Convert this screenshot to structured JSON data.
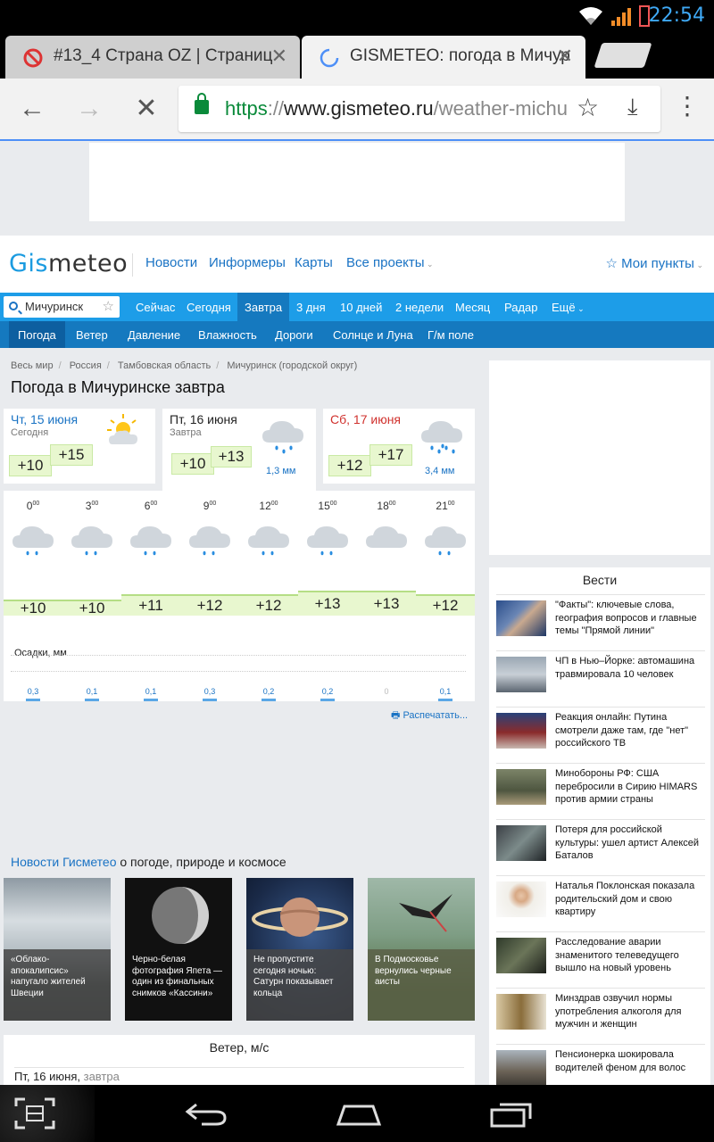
{
  "status_bar": {
    "time": "22:54"
  },
  "tabs": [
    {
      "title": "#13_4 Страна OZ | Страниц",
      "active": false
    },
    {
      "title": "GISMETEO: погода в Мичур",
      "active": true
    }
  ],
  "omnibox": {
    "scheme": "https",
    "sep": "://",
    "host": "www.gismeteo.ru",
    "path": "/weather-michu"
  },
  "site": {
    "logo_a": "Gis",
    "logo_b": "meteo",
    "nav": [
      "Новости",
      "Информеры",
      "Карты",
      "Все проекты"
    ],
    "my_points": "Мои пункты"
  },
  "city_search": {
    "value": "Мичуринск"
  },
  "period_nav": [
    "Сейчас",
    "Сегодня",
    "Завтра",
    "3 дня",
    "10 дней",
    "2 недели",
    "Месяц",
    "Радар",
    "Ещё"
  ],
  "sub_nav": [
    "Погода",
    "Ветер",
    "Давление",
    "Влажность",
    "Дороги",
    "Солнце и Луна",
    "Г/м поле"
  ],
  "breadcrumbs": [
    "Весь мир",
    "Россия",
    "Тамбовская область",
    "Мичуринск (городской округ)"
  ],
  "page_title": "Погода в Мичуринске завтра",
  "days": [
    {
      "name": "Чт, 15 июня",
      "sub": "Сегодня",
      "tmin": "+10",
      "tmax": "+15",
      "precip": "",
      "color": "#1a73c4"
    },
    {
      "name": "Пт, 16 июня",
      "sub": "Завтра",
      "tmin": "+10",
      "tmax": "+13",
      "precip": "1,3 мм",
      "color": "#222222"
    },
    {
      "name": "Сб, 17 июня",
      "sub": "",
      "tmin": "+12",
      "tmax": "+17",
      "precip": "3,4 мм",
      "color": "#d0312d"
    }
  ],
  "hourly": [
    {
      "hour": "0",
      "temp": "+10",
      "precip": "0,3"
    },
    {
      "hour": "3",
      "temp": "+10",
      "precip": "0,1"
    },
    {
      "hour": "6",
      "temp": "+11",
      "precip": "0,1"
    },
    {
      "hour": "9",
      "temp": "+12",
      "precip": "0,3"
    },
    {
      "hour": "12",
      "temp": "+12",
      "precip": "0,2"
    },
    {
      "hour": "15",
      "temp": "+13",
      "precip": "0,2"
    },
    {
      "hour": "18",
      "temp": "+13",
      "precip": "0"
    },
    {
      "hour": "21",
      "temp": "+12",
      "precip": "0,1"
    }
  ],
  "hour_suffix": "00",
  "precip_label": "Осадки, мм",
  "print_label": "Распечатать...",
  "vesti": {
    "title": "Вести",
    "items": [
      "\"Факты\": ключевые слова, география вопросов и главные темы \"Прямой линии\"",
      "ЧП в Нью–Йорке: автомашина травмировала 10 человек",
      "Реакция онлайн: Путина смотрели даже там, где \"нет\" российского ТВ",
      "Минобороны РФ: США перебросили в Сирию HIMARS против армии страны",
      "Потеря для российской культуры: ушел артист Алексей Баталов",
      "Наталья Поклонская показала родительский дом и свою квартиру",
      "Расследование аварии знаменитого телеведущего вышло на новый уровень",
      "Минздрав озвучил нормы употребления алкоголя для мужчин и женщин",
      "Пенсионерка шокировала водителей феном для волос"
    ]
  },
  "news": {
    "title_blue": "Новости Гисметео",
    "title_rest": " о погоде, природе и космосе",
    "cards": [
      "«Облако-апокалипсис» напугало жителей Швеции",
      "Черно-белая фотография Япета — один из финальных снимков «Кассини»",
      "Не пропустите сегодня ночью: Сатурн показывает кольца",
      "В Подмосковье вернулись черные аисты"
    ]
  },
  "wind": {
    "title": "Ветер, м/с",
    "date": "Пт, 16 июня,",
    "date_sub": " завтра"
  }
}
